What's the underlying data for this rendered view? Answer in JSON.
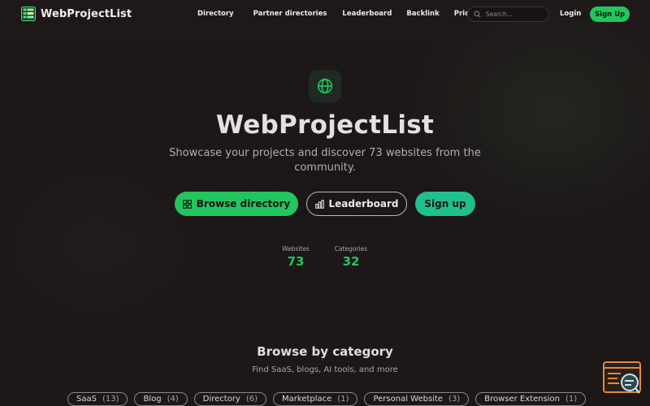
{
  "brand": {
    "name": "WebProjectList"
  },
  "nav": {
    "links": [
      "Directory",
      "Partner directories",
      "Leaderboard",
      "Backlink",
      "Pricing"
    ],
    "search_placeholder": "Search...",
    "login": "Login",
    "signup": "Sign Up"
  },
  "hero": {
    "title": "WebProjectList",
    "subtitle": "Showcase your projects and discover 73 websites from the community.",
    "buttons": {
      "browse": "Browse directory",
      "leaderboard": "Leaderboard",
      "signup": "Sign up"
    },
    "stats": [
      {
        "label": "Websites",
        "value": "73"
      },
      {
        "label": "Categories",
        "value": "32"
      }
    ]
  },
  "categories": {
    "title": "Browse by category",
    "subtitle": "Find SaaS, blogs, AI tools, and more",
    "chips": [
      {
        "name": "SaaS",
        "count": "(13)"
      },
      {
        "name": "Blog",
        "count": "(4)"
      },
      {
        "name": "Directory",
        "count": "(6)"
      },
      {
        "name": "Marketplace",
        "count": "(1)"
      },
      {
        "name": "Personal Website",
        "count": "(3)"
      },
      {
        "name": "Browser Extension",
        "count": "(1)"
      }
    ]
  },
  "colors": {
    "accent": "#22c55e",
    "accent_teal": "#20bf8e",
    "background": "#1c1718"
  },
  "icons": [
    "logo-grid-icon",
    "search-icon",
    "globe-icon",
    "grid-icon",
    "bar-chart-icon",
    "chat-widget-icon"
  ]
}
